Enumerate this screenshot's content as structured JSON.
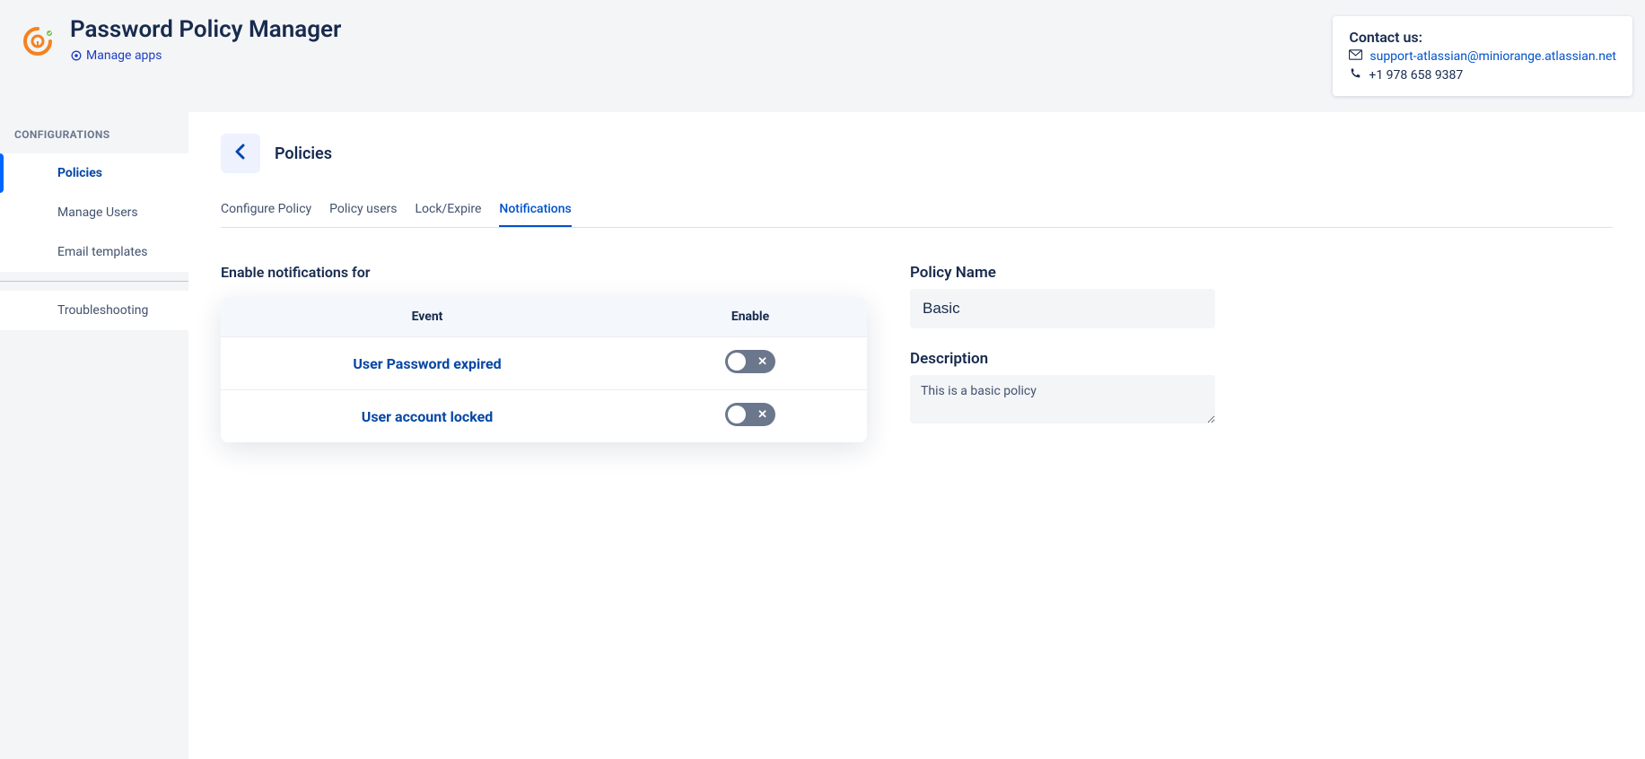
{
  "header": {
    "app_title": "Password Policy Manager",
    "manage_apps_label": "Manage apps"
  },
  "contact": {
    "title": "Contact us:",
    "email": "support-atlassian@miniorange.atlassian.net",
    "phone": "+1 978 658 9387"
  },
  "sidebar": {
    "heading": "CONFIGURATIONS",
    "items": [
      {
        "label": "Policies"
      },
      {
        "label": "Manage Users"
      },
      {
        "label": "Email templates"
      },
      {
        "label": "Troubleshooting"
      }
    ]
  },
  "page": {
    "title": "Policies"
  },
  "tabs": [
    {
      "label": "Configure Policy"
    },
    {
      "label": "Policy users"
    },
    {
      "label": "Lock/Expire"
    },
    {
      "label": "Notifications"
    }
  ],
  "notifications": {
    "section_title": "Enable notifications for",
    "columns": {
      "event": "Event",
      "enable": "Enable"
    },
    "rows": [
      {
        "event": "User Password expired",
        "enabled": false
      },
      {
        "event": "User account locked",
        "enabled": false
      }
    ]
  },
  "policy_form": {
    "name_label": "Policy Name",
    "name_value": "Basic",
    "description_label": "Description",
    "description_value": "This is a basic policy"
  }
}
